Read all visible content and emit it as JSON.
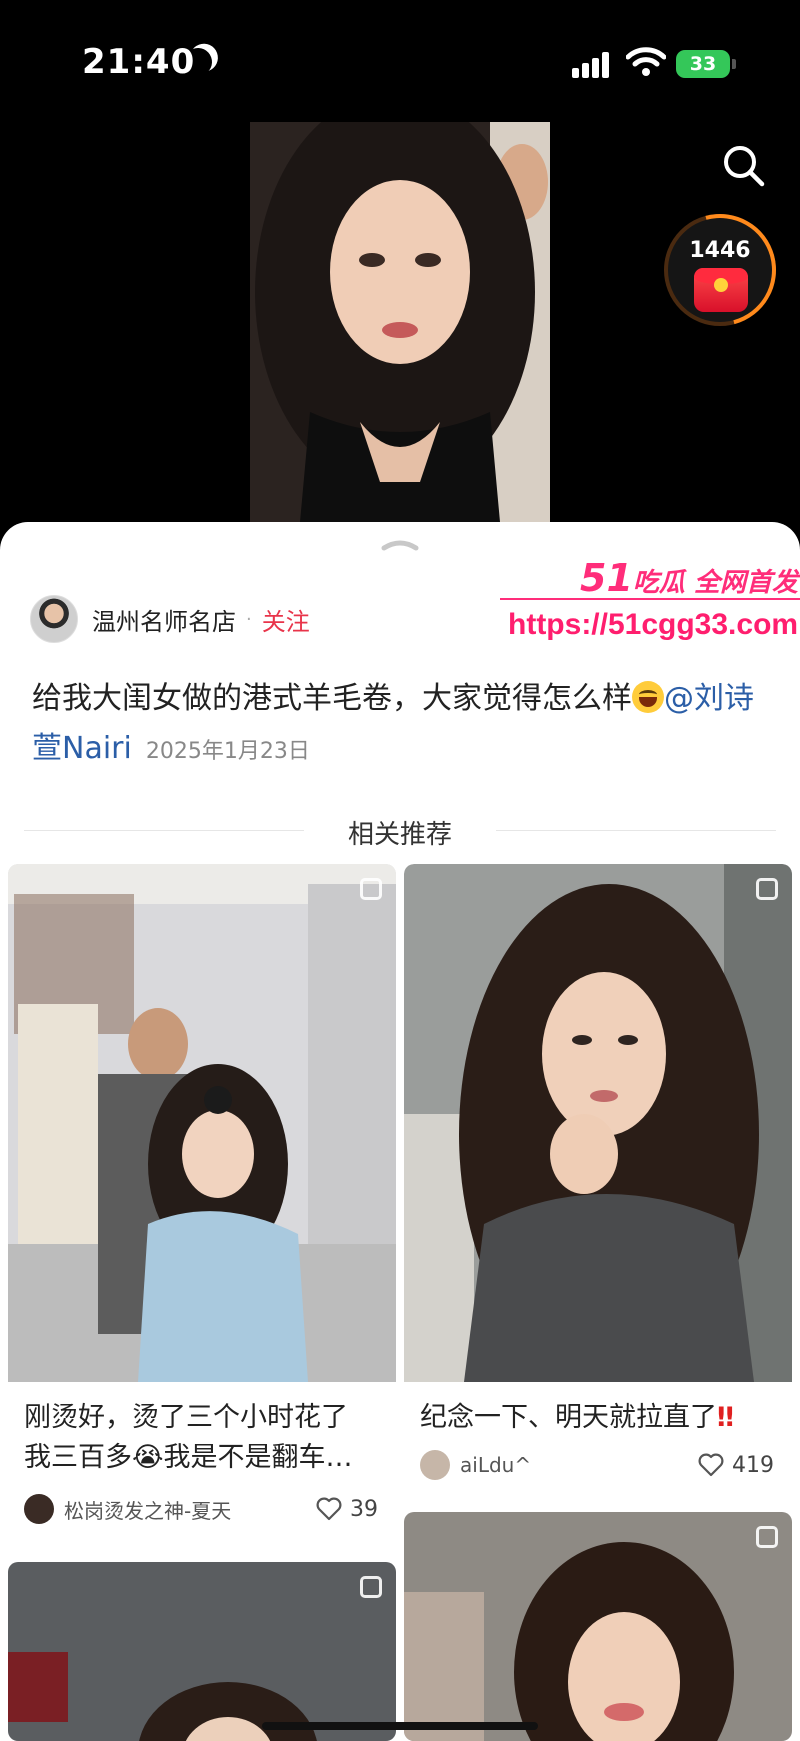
{
  "status": {
    "time": "21:40",
    "battery": "33"
  },
  "reward": {
    "count": "1446"
  },
  "post": {
    "author": "温州名师名店",
    "follow_label": "关注",
    "caption": "给我大闺女做的港式羊毛卷，大家觉得怎么样",
    "mention": "@刘诗萱Nairi",
    "date": "2025年1月23日"
  },
  "section_title": "相关推荐",
  "cards": [
    {
      "title": "刚烫好，烫了三个小时花了我三百多😭我是不是翻车…",
      "title_line1": "刚烫好，烫了三个小时花了",
      "title_line2": "我三百多😭我是不是翻车…",
      "author": "松岗烫发之神-夏天",
      "likes": "39"
    },
    {
      "title": "纪念一下、明天就拉直了‼️",
      "title_text": "纪念一下、明天就拉直了",
      "author": "aiLdu^",
      "likes": "419"
    }
  ],
  "watermark": {
    "brand_num": "51",
    "brand_text": "吃瓜 全网首发",
    "url": "https://51cgg33.com"
  },
  "icons": {
    "search": "search-icon",
    "reward": "red-packet-icon",
    "heart": "heart-icon",
    "multi": "multi-image-icon"
  }
}
